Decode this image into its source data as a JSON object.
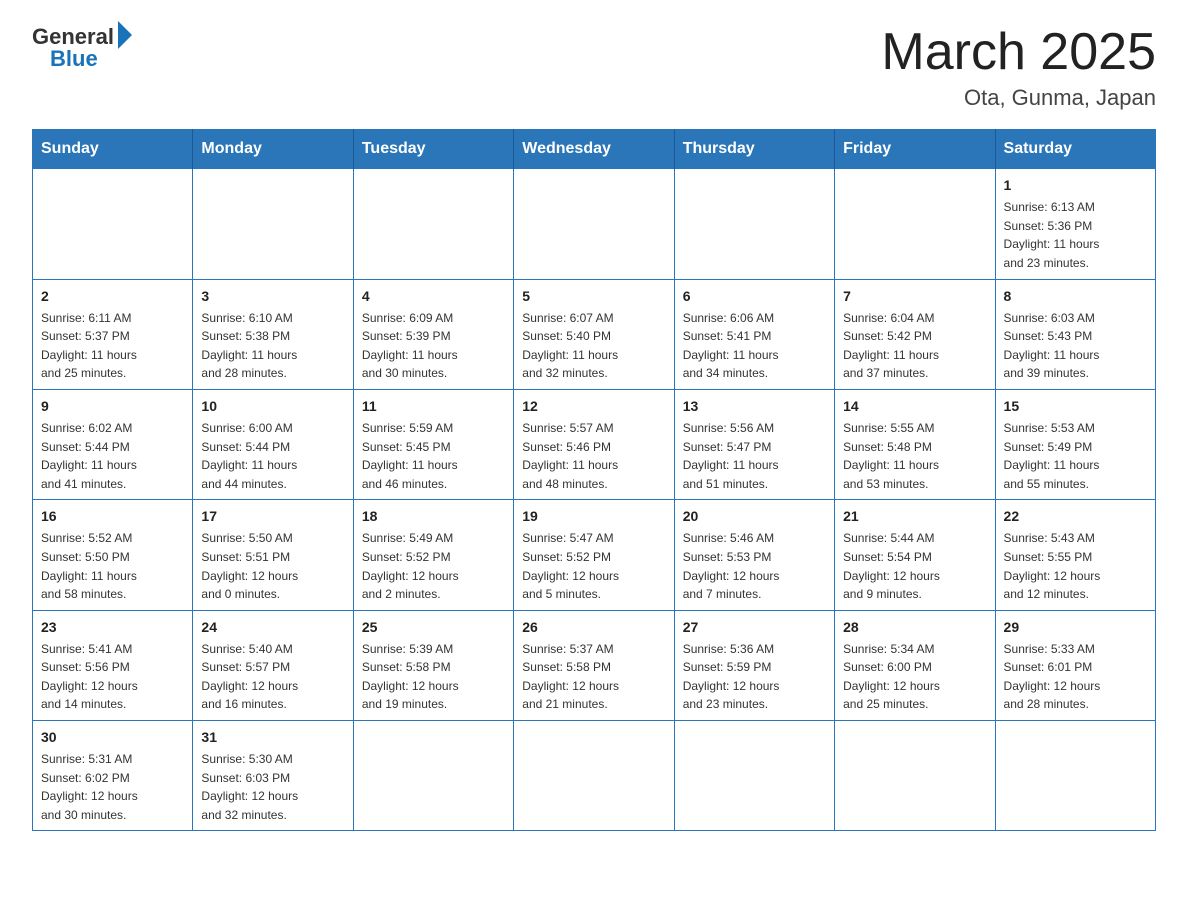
{
  "logo": {
    "general": "General",
    "blue": "Blue"
  },
  "title": "March 2025",
  "subtitle": "Ota, Gunma, Japan",
  "weekdays": [
    "Sunday",
    "Monday",
    "Tuesday",
    "Wednesday",
    "Thursday",
    "Friday",
    "Saturday"
  ],
  "weeks": [
    [
      {
        "day": "",
        "info": ""
      },
      {
        "day": "",
        "info": ""
      },
      {
        "day": "",
        "info": ""
      },
      {
        "day": "",
        "info": ""
      },
      {
        "day": "",
        "info": ""
      },
      {
        "day": "",
        "info": ""
      },
      {
        "day": "1",
        "info": "Sunrise: 6:13 AM\nSunset: 5:36 PM\nDaylight: 11 hours\nand 23 minutes."
      }
    ],
    [
      {
        "day": "2",
        "info": "Sunrise: 6:11 AM\nSunset: 5:37 PM\nDaylight: 11 hours\nand 25 minutes."
      },
      {
        "day": "3",
        "info": "Sunrise: 6:10 AM\nSunset: 5:38 PM\nDaylight: 11 hours\nand 28 minutes."
      },
      {
        "day": "4",
        "info": "Sunrise: 6:09 AM\nSunset: 5:39 PM\nDaylight: 11 hours\nand 30 minutes."
      },
      {
        "day": "5",
        "info": "Sunrise: 6:07 AM\nSunset: 5:40 PM\nDaylight: 11 hours\nand 32 minutes."
      },
      {
        "day": "6",
        "info": "Sunrise: 6:06 AM\nSunset: 5:41 PM\nDaylight: 11 hours\nand 34 minutes."
      },
      {
        "day": "7",
        "info": "Sunrise: 6:04 AM\nSunset: 5:42 PM\nDaylight: 11 hours\nand 37 minutes."
      },
      {
        "day": "8",
        "info": "Sunrise: 6:03 AM\nSunset: 5:43 PM\nDaylight: 11 hours\nand 39 minutes."
      }
    ],
    [
      {
        "day": "9",
        "info": "Sunrise: 6:02 AM\nSunset: 5:44 PM\nDaylight: 11 hours\nand 41 minutes."
      },
      {
        "day": "10",
        "info": "Sunrise: 6:00 AM\nSunset: 5:44 PM\nDaylight: 11 hours\nand 44 minutes."
      },
      {
        "day": "11",
        "info": "Sunrise: 5:59 AM\nSunset: 5:45 PM\nDaylight: 11 hours\nand 46 minutes."
      },
      {
        "day": "12",
        "info": "Sunrise: 5:57 AM\nSunset: 5:46 PM\nDaylight: 11 hours\nand 48 minutes."
      },
      {
        "day": "13",
        "info": "Sunrise: 5:56 AM\nSunset: 5:47 PM\nDaylight: 11 hours\nand 51 minutes."
      },
      {
        "day": "14",
        "info": "Sunrise: 5:55 AM\nSunset: 5:48 PM\nDaylight: 11 hours\nand 53 minutes."
      },
      {
        "day": "15",
        "info": "Sunrise: 5:53 AM\nSunset: 5:49 PM\nDaylight: 11 hours\nand 55 minutes."
      }
    ],
    [
      {
        "day": "16",
        "info": "Sunrise: 5:52 AM\nSunset: 5:50 PM\nDaylight: 11 hours\nand 58 minutes."
      },
      {
        "day": "17",
        "info": "Sunrise: 5:50 AM\nSunset: 5:51 PM\nDaylight: 12 hours\nand 0 minutes."
      },
      {
        "day": "18",
        "info": "Sunrise: 5:49 AM\nSunset: 5:52 PM\nDaylight: 12 hours\nand 2 minutes."
      },
      {
        "day": "19",
        "info": "Sunrise: 5:47 AM\nSunset: 5:52 PM\nDaylight: 12 hours\nand 5 minutes."
      },
      {
        "day": "20",
        "info": "Sunrise: 5:46 AM\nSunset: 5:53 PM\nDaylight: 12 hours\nand 7 minutes."
      },
      {
        "day": "21",
        "info": "Sunrise: 5:44 AM\nSunset: 5:54 PM\nDaylight: 12 hours\nand 9 minutes."
      },
      {
        "day": "22",
        "info": "Sunrise: 5:43 AM\nSunset: 5:55 PM\nDaylight: 12 hours\nand 12 minutes."
      }
    ],
    [
      {
        "day": "23",
        "info": "Sunrise: 5:41 AM\nSunset: 5:56 PM\nDaylight: 12 hours\nand 14 minutes."
      },
      {
        "day": "24",
        "info": "Sunrise: 5:40 AM\nSunset: 5:57 PM\nDaylight: 12 hours\nand 16 minutes."
      },
      {
        "day": "25",
        "info": "Sunrise: 5:39 AM\nSunset: 5:58 PM\nDaylight: 12 hours\nand 19 minutes."
      },
      {
        "day": "26",
        "info": "Sunrise: 5:37 AM\nSunset: 5:58 PM\nDaylight: 12 hours\nand 21 minutes."
      },
      {
        "day": "27",
        "info": "Sunrise: 5:36 AM\nSunset: 5:59 PM\nDaylight: 12 hours\nand 23 minutes."
      },
      {
        "day": "28",
        "info": "Sunrise: 5:34 AM\nSunset: 6:00 PM\nDaylight: 12 hours\nand 25 minutes."
      },
      {
        "day": "29",
        "info": "Sunrise: 5:33 AM\nSunset: 6:01 PM\nDaylight: 12 hours\nand 28 minutes."
      }
    ],
    [
      {
        "day": "30",
        "info": "Sunrise: 5:31 AM\nSunset: 6:02 PM\nDaylight: 12 hours\nand 30 minutes."
      },
      {
        "day": "31",
        "info": "Sunrise: 5:30 AM\nSunset: 6:03 PM\nDaylight: 12 hours\nand 32 minutes."
      },
      {
        "day": "",
        "info": ""
      },
      {
        "day": "",
        "info": ""
      },
      {
        "day": "",
        "info": ""
      },
      {
        "day": "",
        "info": ""
      },
      {
        "day": "",
        "info": ""
      }
    ]
  ]
}
